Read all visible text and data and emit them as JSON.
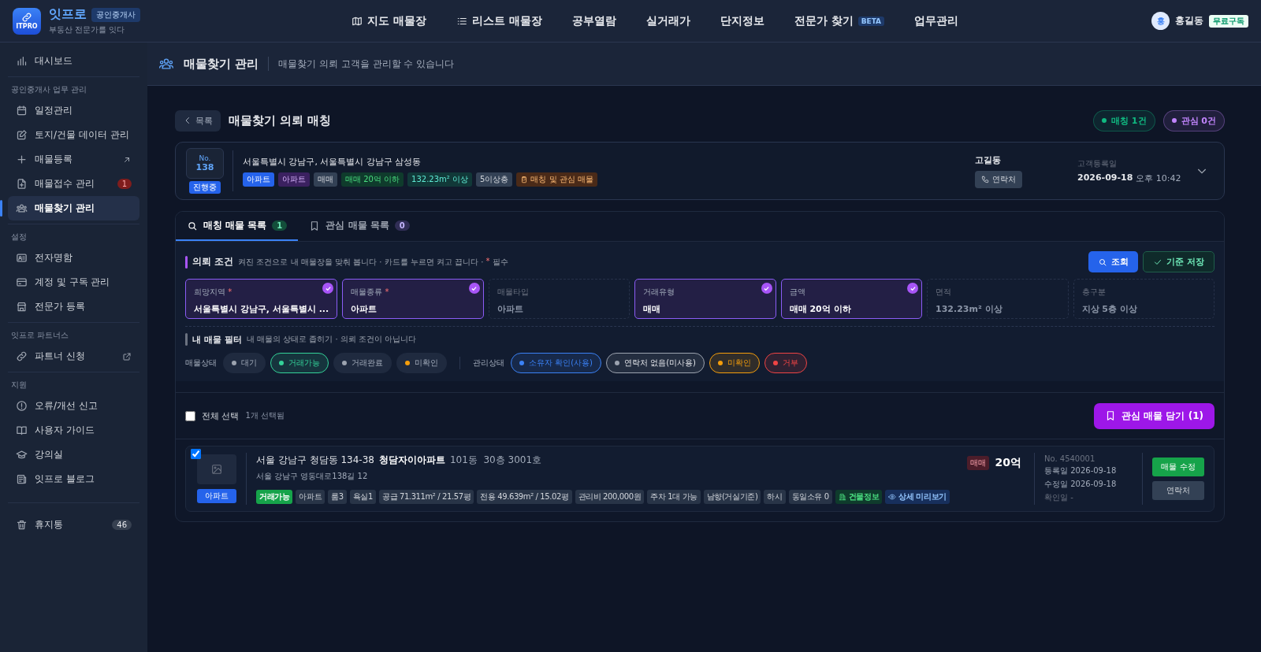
{
  "header": {
    "logo": {
      "mark": "ITPRO",
      "name": "잇프로",
      "badge": "공인중개사",
      "tagline": "부동산 전문가를 잇다"
    },
    "nav": [
      {
        "label": "지도 매물장",
        "selected": false
      },
      {
        "label": "리스트 매물장",
        "selected": false
      },
      {
        "label": "공부열람",
        "selected": false
      },
      {
        "label": "실거래가",
        "selected": false
      },
      {
        "label": "단지정보",
        "selected": false
      },
      {
        "label": "전문가 찾기",
        "badge": "BETA",
        "selected": false
      },
      {
        "label": "업무관리",
        "selected": false
      }
    ],
    "user": {
      "initial": "홍",
      "name": "홍길동",
      "plan": "무료구독"
    }
  },
  "sidebar": {
    "sections": [
      {
        "items": [
          {
            "label": "대시보드",
            "selected": false
          }
        ]
      },
      {
        "title": "공인중개사 업무 관리",
        "items": [
          {
            "label": "일정관리",
            "selected": false
          },
          {
            "label": "토지/건물 데이터 관리",
            "selected": false
          },
          {
            "label": "매물등록",
            "selected": false
          },
          {
            "label": "매물접수 관리",
            "badge": "1",
            "selected": false
          },
          {
            "label": "매물찾기 관리",
            "selected": true
          }
        ]
      },
      {
        "title": "설정",
        "items": [
          {
            "label": "전자명함",
            "selected": false
          },
          {
            "label": "계정 및 구독 관리",
            "selected": false
          },
          {
            "label": "전문가 등록",
            "selected": false
          }
        ]
      },
      {
        "title": "잇프로 파트너스",
        "items": [
          {
            "label": "파트너 신청",
            "selected": false
          }
        ]
      },
      {
        "title": "지원",
        "items": [
          {
            "label": "오류/개선 신고",
            "selected": false
          },
          {
            "label": "사용자 가이드",
            "selected": false
          },
          {
            "label": "강의실",
            "selected": false
          },
          {
            "label": "잇프로 블로그",
            "selected": false
          }
        ]
      },
      {
        "items": [
          {
            "label": "휴지통",
            "badge": "46",
            "selected": false
          }
        ]
      }
    ]
  },
  "page_header": {
    "title": "매물찾기 관리",
    "subtitle": "매물찾기 의뢰 고객을 관리할 수 있습니다"
  },
  "request": {
    "back": "목록",
    "title": "매물찾기 의뢰 매칭",
    "counts": [
      {
        "label": "매칭 1건",
        "color": "#10b981"
      },
      {
        "label": "관심 0건",
        "color": "#c084fc"
      }
    ],
    "card": {
      "no_label": "No.",
      "number": "138",
      "status": "진행중",
      "address": "서울특별시 강남구, 서울특별시 강남구 삼성동",
      "tags": [
        {
          "label": "아파트",
          "kind": "primary"
        },
        {
          "label": "아파트",
          "kind": "purple"
        },
        {
          "label": "매매",
          "kind": "gray"
        },
        {
          "label": "매매 20억 이하",
          "kind": "green"
        },
        {
          "label": "132.23m² 이상",
          "kind": "teal"
        },
        {
          "label": "5이상층",
          "kind": "gray"
        },
        {
          "label": "매칭 및 관심 매물",
          "kind": "orange"
        }
      ],
      "client": "고길동",
      "contact": "연락처",
      "date_label": "고객등록일",
      "date": "2026-09-18",
      "time": "오후 10:42",
      "expanded": false
    }
  },
  "tabs": [
    {
      "label": "매칭 매물 목록",
      "count": "1",
      "selected": true
    },
    {
      "label": "관심 매물 목록",
      "count": "0",
      "selected": false
    }
  ],
  "conditions": {
    "title": "의뢰 조건",
    "hint": "켜진 조건으로 내 매물장을 맞춰 봅니다 · 카드를 누르면 켜고 끕니다 ·",
    "required_mark": "*",
    "required_label": "필수",
    "search": "조회",
    "save": "기준 저장",
    "cards": [
      {
        "label": "희망지역",
        "required": true,
        "value": "서울특별시 강남구, 서울특별시 ...",
        "on": true
      },
      {
        "label": "매물종류",
        "required": true,
        "value": "아파트",
        "on": true
      },
      {
        "label": "매물타입",
        "required": false,
        "value": "아파트",
        "on": false
      },
      {
        "label": "거래유형",
        "required": false,
        "value": "매매",
        "on": true
      },
      {
        "label": "금액",
        "required": false,
        "value": "매매 20억 이하",
        "on": true
      },
      {
        "label": "면적",
        "required": false,
        "value": "132.23m² 이상",
        "on": false
      },
      {
        "label": "층구분",
        "required": false,
        "value": "지상 5층 이상",
        "on": false
      }
    ]
  },
  "filter": {
    "title": "내 매물 필터",
    "hint": "내 매물의 상태로 좁히기 · 의뢰 조건이 아닙니다",
    "groups": [
      {
        "label": "매물상태",
        "chips": [
          {
            "label": "대기",
            "color": "#9ca3af",
            "selected": false
          },
          {
            "label": "거래가능",
            "color": "#34d399",
            "selected": true
          },
          {
            "label": "거래완료",
            "color": "#9ca3af",
            "selected": false
          },
          {
            "label": "미확인",
            "color": "#f59e0b",
            "selected": false
          }
        ]
      },
      {
        "label": "관리상태",
        "chips": [
          {
            "label": "소유자 확인(사용)",
            "color": "#3b82f6",
            "selected": true
          },
          {
            "label": "연락처 없음(미사용)",
            "color": "#9ca3af",
            "selected": true
          },
          {
            "label": "미확인",
            "color": "#f59e0b",
            "selected": true
          },
          {
            "label": "거부",
            "color": "#ef4444",
            "selected": true
          }
        ]
      }
    ]
  },
  "selection": {
    "label": "전체 선택",
    "checked": false,
    "count": "1개 선택됨",
    "add_button": "관심 매물 담기 (1)"
  },
  "listings": [
    {
      "checked": true,
      "type": "아파트",
      "address": "서울 강남구 청담동 134-38",
      "building": "청담자이아파트",
      "unit": "101동  30층 3001호",
      "road": "서울 강남구 영동대로138길 12",
      "tags": [
        {
          "label": "거래가능",
          "kind": "status"
        },
        {
          "label": "아파트",
          "kind": "plain"
        },
        {
          "label": "룸3",
          "kind": "plain"
        },
        {
          "label": "욕실1",
          "kind": "plain"
        },
        {
          "label": "공급 71.311m² / 21.57평",
          "kind": "plain"
        },
        {
          "label": "전용 49.639m² / 15.02평",
          "kind": "plain"
        },
        {
          "label": "관리비 200,000원",
          "kind": "plain"
        },
        {
          "label": "주차 1대 가능",
          "kind": "plain"
        },
        {
          "label": "남향(거실기준)",
          "kind": "plain"
        },
        {
          "label": "하시",
          "kind": "plain"
        },
        {
          "label": "동일소유 0",
          "kind": "plain"
        },
        {
          "label": "건물정보",
          "kind": "building"
        },
        {
          "label": "상세 미리보기",
          "kind": "preview"
        }
      ],
      "deal": "매매",
      "price": "20억",
      "no": "No. 4540001",
      "registered": "등록일 2026-09-18",
      "modified": "수정일 2026-09-18",
      "confirmed": "확인일 -",
      "edit": "매물 수정",
      "contact": "연락처"
    }
  ]
}
